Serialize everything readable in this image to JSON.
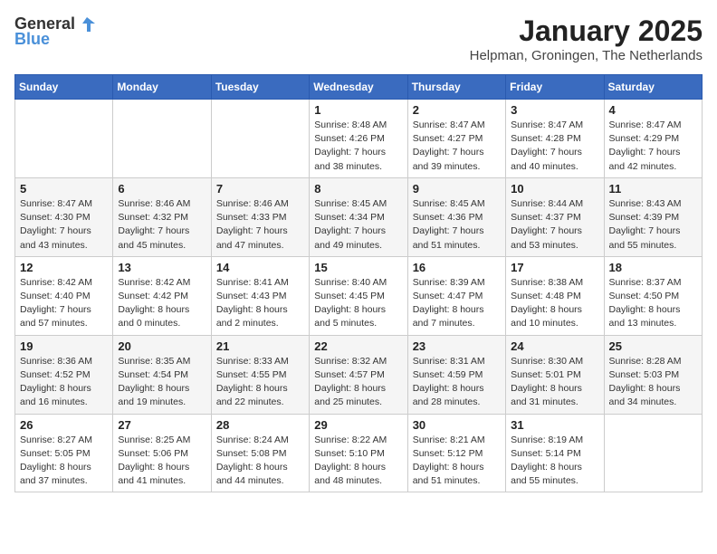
{
  "header": {
    "logo_general": "General",
    "logo_blue": "Blue",
    "month": "January 2025",
    "location": "Helpman, Groningen, The Netherlands"
  },
  "weekdays": [
    "Sunday",
    "Monday",
    "Tuesday",
    "Wednesday",
    "Thursday",
    "Friday",
    "Saturday"
  ],
  "weeks": [
    [
      {
        "day": "",
        "sunrise": "",
        "sunset": "",
        "daylight": ""
      },
      {
        "day": "",
        "sunrise": "",
        "sunset": "",
        "daylight": ""
      },
      {
        "day": "",
        "sunrise": "",
        "sunset": "",
        "daylight": ""
      },
      {
        "day": "1",
        "sunrise": "Sunrise: 8:48 AM",
        "sunset": "Sunset: 4:26 PM",
        "daylight": "Daylight: 7 hours and 38 minutes."
      },
      {
        "day": "2",
        "sunrise": "Sunrise: 8:47 AM",
        "sunset": "Sunset: 4:27 PM",
        "daylight": "Daylight: 7 hours and 39 minutes."
      },
      {
        "day": "3",
        "sunrise": "Sunrise: 8:47 AM",
        "sunset": "Sunset: 4:28 PM",
        "daylight": "Daylight: 7 hours and 40 minutes."
      },
      {
        "day": "4",
        "sunrise": "Sunrise: 8:47 AM",
        "sunset": "Sunset: 4:29 PM",
        "daylight": "Daylight: 7 hours and 42 minutes."
      }
    ],
    [
      {
        "day": "5",
        "sunrise": "Sunrise: 8:47 AM",
        "sunset": "Sunset: 4:30 PM",
        "daylight": "Daylight: 7 hours and 43 minutes."
      },
      {
        "day": "6",
        "sunrise": "Sunrise: 8:46 AM",
        "sunset": "Sunset: 4:32 PM",
        "daylight": "Daylight: 7 hours and 45 minutes."
      },
      {
        "day": "7",
        "sunrise": "Sunrise: 8:46 AM",
        "sunset": "Sunset: 4:33 PM",
        "daylight": "Daylight: 7 hours and 47 minutes."
      },
      {
        "day": "8",
        "sunrise": "Sunrise: 8:45 AM",
        "sunset": "Sunset: 4:34 PM",
        "daylight": "Daylight: 7 hours and 49 minutes."
      },
      {
        "day": "9",
        "sunrise": "Sunrise: 8:45 AM",
        "sunset": "Sunset: 4:36 PM",
        "daylight": "Daylight: 7 hours and 51 minutes."
      },
      {
        "day": "10",
        "sunrise": "Sunrise: 8:44 AM",
        "sunset": "Sunset: 4:37 PM",
        "daylight": "Daylight: 7 hours and 53 minutes."
      },
      {
        "day": "11",
        "sunrise": "Sunrise: 8:43 AM",
        "sunset": "Sunset: 4:39 PM",
        "daylight": "Daylight: 7 hours and 55 minutes."
      }
    ],
    [
      {
        "day": "12",
        "sunrise": "Sunrise: 8:42 AM",
        "sunset": "Sunset: 4:40 PM",
        "daylight": "Daylight: 7 hours and 57 minutes."
      },
      {
        "day": "13",
        "sunrise": "Sunrise: 8:42 AM",
        "sunset": "Sunset: 4:42 PM",
        "daylight": "Daylight: 8 hours and 0 minutes."
      },
      {
        "day": "14",
        "sunrise": "Sunrise: 8:41 AM",
        "sunset": "Sunset: 4:43 PM",
        "daylight": "Daylight: 8 hours and 2 minutes."
      },
      {
        "day": "15",
        "sunrise": "Sunrise: 8:40 AM",
        "sunset": "Sunset: 4:45 PM",
        "daylight": "Daylight: 8 hours and 5 minutes."
      },
      {
        "day": "16",
        "sunrise": "Sunrise: 8:39 AM",
        "sunset": "Sunset: 4:47 PM",
        "daylight": "Daylight: 8 hours and 7 minutes."
      },
      {
        "day": "17",
        "sunrise": "Sunrise: 8:38 AM",
        "sunset": "Sunset: 4:48 PM",
        "daylight": "Daylight: 8 hours and 10 minutes."
      },
      {
        "day": "18",
        "sunrise": "Sunrise: 8:37 AM",
        "sunset": "Sunset: 4:50 PM",
        "daylight": "Daylight: 8 hours and 13 minutes."
      }
    ],
    [
      {
        "day": "19",
        "sunrise": "Sunrise: 8:36 AM",
        "sunset": "Sunset: 4:52 PM",
        "daylight": "Daylight: 8 hours and 16 minutes."
      },
      {
        "day": "20",
        "sunrise": "Sunrise: 8:35 AM",
        "sunset": "Sunset: 4:54 PM",
        "daylight": "Daylight: 8 hours and 19 minutes."
      },
      {
        "day": "21",
        "sunrise": "Sunrise: 8:33 AM",
        "sunset": "Sunset: 4:55 PM",
        "daylight": "Daylight: 8 hours and 22 minutes."
      },
      {
        "day": "22",
        "sunrise": "Sunrise: 8:32 AM",
        "sunset": "Sunset: 4:57 PM",
        "daylight": "Daylight: 8 hours and 25 minutes."
      },
      {
        "day": "23",
        "sunrise": "Sunrise: 8:31 AM",
        "sunset": "Sunset: 4:59 PM",
        "daylight": "Daylight: 8 hours and 28 minutes."
      },
      {
        "day": "24",
        "sunrise": "Sunrise: 8:30 AM",
        "sunset": "Sunset: 5:01 PM",
        "daylight": "Daylight: 8 hours and 31 minutes."
      },
      {
        "day": "25",
        "sunrise": "Sunrise: 8:28 AM",
        "sunset": "Sunset: 5:03 PM",
        "daylight": "Daylight: 8 hours and 34 minutes."
      }
    ],
    [
      {
        "day": "26",
        "sunrise": "Sunrise: 8:27 AM",
        "sunset": "Sunset: 5:05 PM",
        "daylight": "Daylight: 8 hours and 37 minutes."
      },
      {
        "day": "27",
        "sunrise": "Sunrise: 8:25 AM",
        "sunset": "Sunset: 5:06 PM",
        "daylight": "Daylight: 8 hours and 41 minutes."
      },
      {
        "day": "28",
        "sunrise": "Sunrise: 8:24 AM",
        "sunset": "Sunset: 5:08 PM",
        "daylight": "Daylight: 8 hours and 44 minutes."
      },
      {
        "day": "29",
        "sunrise": "Sunrise: 8:22 AM",
        "sunset": "Sunset: 5:10 PM",
        "daylight": "Daylight: 8 hours and 48 minutes."
      },
      {
        "day": "30",
        "sunrise": "Sunrise: 8:21 AM",
        "sunset": "Sunset: 5:12 PM",
        "daylight": "Daylight: 8 hours and 51 minutes."
      },
      {
        "day": "31",
        "sunrise": "Sunrise: 8:19 AM",
        "sunset": "Sunset: 5:14 PM",
        "daylight": "Daylight: 8 hours and 55 minutes."
      },
      {
        "day": "",
        "sunrise": "",
        "sunset": "",
        "daylight": ""
      }
    ]
  ]
}
